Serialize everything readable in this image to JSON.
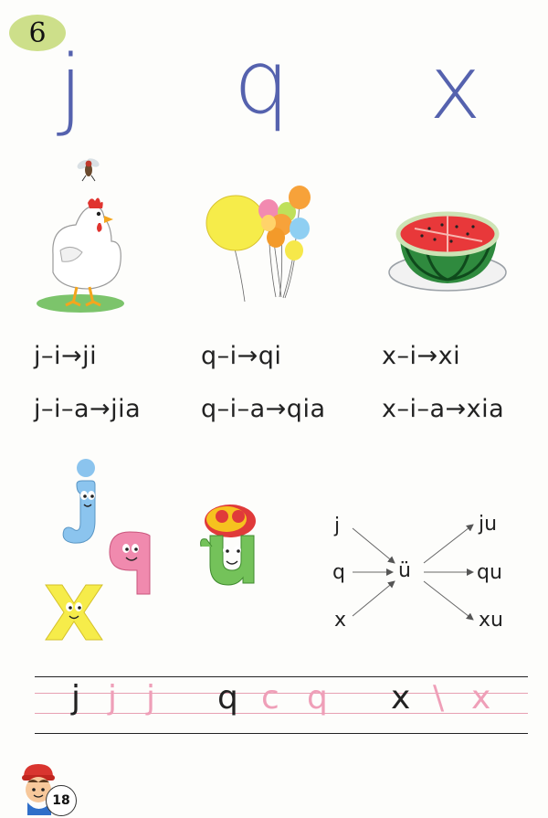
{
  "lesson": {
    "number": "6"
  },
  "letters": [
    "j",
    "q",
    "x"
  ],
  "spellings": {
    "row1": [
      "j–i→ji",
      "q–i→qi",
      "x–i→xi"
    ],
    "row2": [
      "j–i–a→jia",
      "q–i–a→qia",
      "x–i–a→xia"
    ]
  },
  "combination": {
    "initials": [
      "j",
      "q",
      "x"
    ],
    "vowel": "ü",
    "results": [
      "ju",
      "qu",
      "xu"
    ]
  },
  "writing_practice": [
    {
      "model": "j",
      "traces": [
        "j",
        "j"
      ]
    },
    {
      "model": "q",
      "traces": [
        "c",
        "q"
      ]
    },
    {
      "model": "x",
      "traces": [
        "\\",
        "x"
      ]
    }
  ],
  "page": {
    "number": "18"
  },
  "colors": {
    "letter_blue": "#5562ae",
    "badge_green": "#cddf8a",
    "trace_pink": "#ef9fb8",
    "guide_pink": "#e7a1b2"
  },
  "icons": [
    "hen-icon",
    "fly-icon",
    "balloons-icon",
    "watermelon-icon",
    "letter-j-character-icon",
    "letter-q-character-icon",
    "letter-x-character-icon",
    "u-umlaut-character-icon",
    "child-mascot-icon"
  ]
}
